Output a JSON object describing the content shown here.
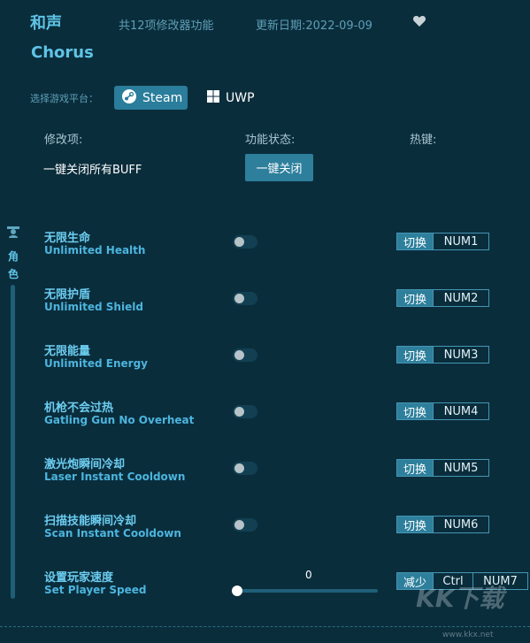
{
  "header": {
    "title_cn": "和声",
    "title_en": "Chorus",
    "feature_count": "共12项修改器功能",
    "update_date": "更新日期:2022-09-09",
    "favorite_icon": "heart-icon"
  },
  "platform": {
    "label": "选择游戏平台：",
    "options": [
      {
        "label": "Steam",
        "icon": "steam-icon",
        "selected": true
      },
      {
        "label": "UWP",
        "icon": "windows-icon",
        "selected": false
      }
    ]
  },
  "columns": {
    "item": "修改项:",
    "status": "功能状态:",
    "hotkey": "热键:"
  },
  "buff": {
    "label": "一键关闭所有BUFF",
    "button": "一键关闭"
  },
  "sidebar": {
    "category_icon": "character-icon",
    "category_label_1": "角",
    "category_label_2": "色"
  },
  "cheats": [
    {
      "cn": "无限生命",
      "en": "Unlimited Health",
      "enabled": false,
      "action": "切换",
      "keys": [
        "NUM1"
      ]
    },
    {
      "cn": "无限护盾",
      "en": "Unlimited Shield",
      "enabled": false,
      "action": "切换",
      "keys": [
        "NUM2"
      ]
    },
    {
      "cn": "无限能量",
      "en": "Unlimited Energy",
      "enabled": false,
      "action": "切换",
      "keys": [
        "NUM3"
      ]
    },
    {
      "cn": "机枪不会过热",
      "en": "Gatling Gun No Overheat",
      "enabled": false,
      "action": "切换",
      "keys": [
        "NUM4"
      ]
    },
    {
      "cn": "激光炮瞬间冷却",
      "en": "Laser Instant Cooldown",
      "enabled": false,
      "action": "切换",
      "keys": [
        "NUM5"
      ]
    },
    {
      "cn": "扫描技能瞬间冷却",
      "en": "Scan Instant Cooldown",
      "enabled": false,
      "action": "切换",
      "keys": [
        "NUM6"
      ]
    }
  ],
  "speed": {
    "cn": "设置玩家速度",
    "en": "Set Player Speed",
    "value": "0",
    "action": "减少",
    "keys": [
      "Ctrl",
      "NUM7"
    ]
  },
  "watermark": {
    "logo": "KK下载",
    "url": "www.kkx.net"
  },
  "colors": {
    "background": "#0a2d3c",
    "accent": "#2d7f9c",
    "title": "#5fc4e6"
  }
}
